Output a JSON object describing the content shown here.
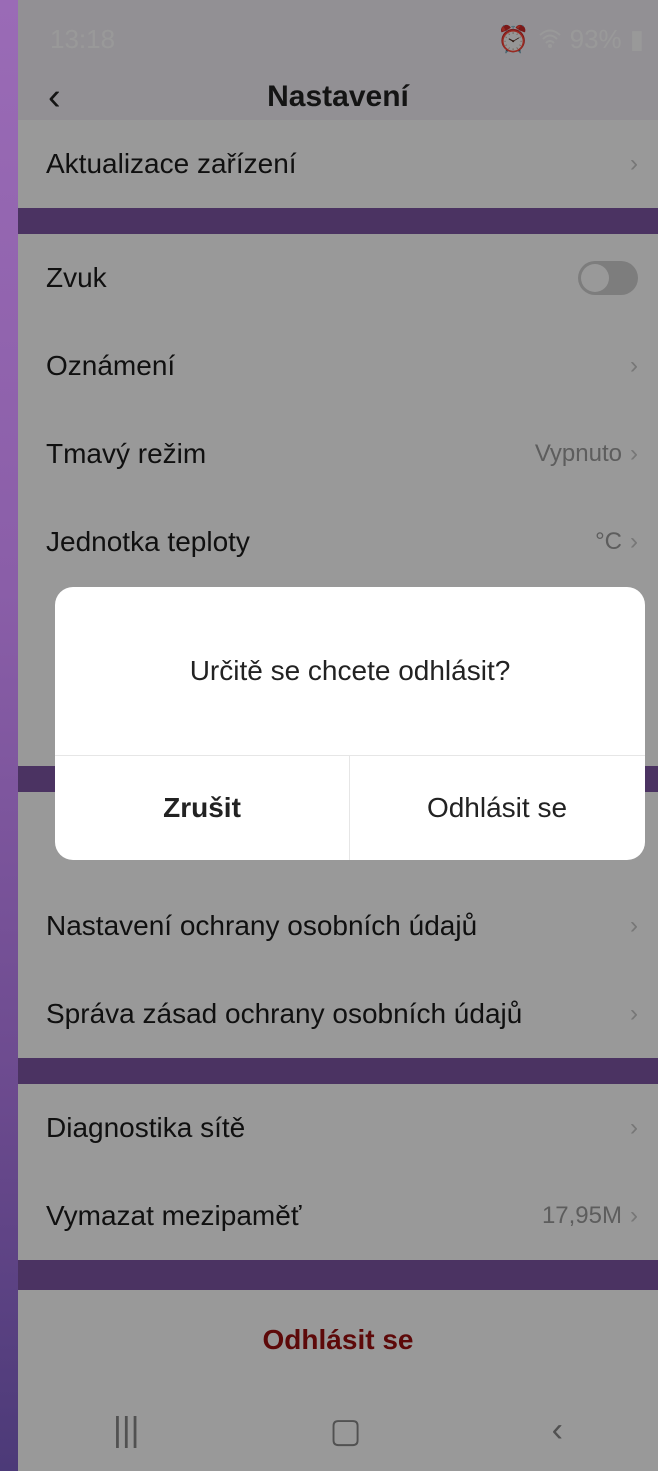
{
  "status_bar": {
    "time": "13:18",
    "mail_icon": "M",
    "battery": "93%"
  },
  "header": {
    "title": "Nastavení"
  },
  "rows": [
    {
      "label": "Aktualizace zařízení"
    },
    {
      "label": "Zvuk"
    },
    {
      "label": "Oznámení"
    },
    {
      "label": "Tmavý režim",
      "value": "Vypnuto"
    },
    {
      "label": "Jednotka teploty",
      "value": "°C"
    },
    {
      "label": "Nastavení ochrany osobních údajů"
    },
    {
      "label": "Správa zásad ochrany osobních údajů"
    },
    {
      "label": "Diagnostika sítě"
    },
    {
      "label": "Vymazat mezipaměť",
      "value": "17,95M"
    }
  ],
  "logout_button": "Odhlásit se",
  "dialog": {
    "message": "Určitě se chcete odhlásit?",
    "cancel": "Zrušit",
    "confirm": "Odhlásit se"
  },
  "colors": {
    "accent": "#7d55a3",
    "logout": "#9b1010"
  }
}
